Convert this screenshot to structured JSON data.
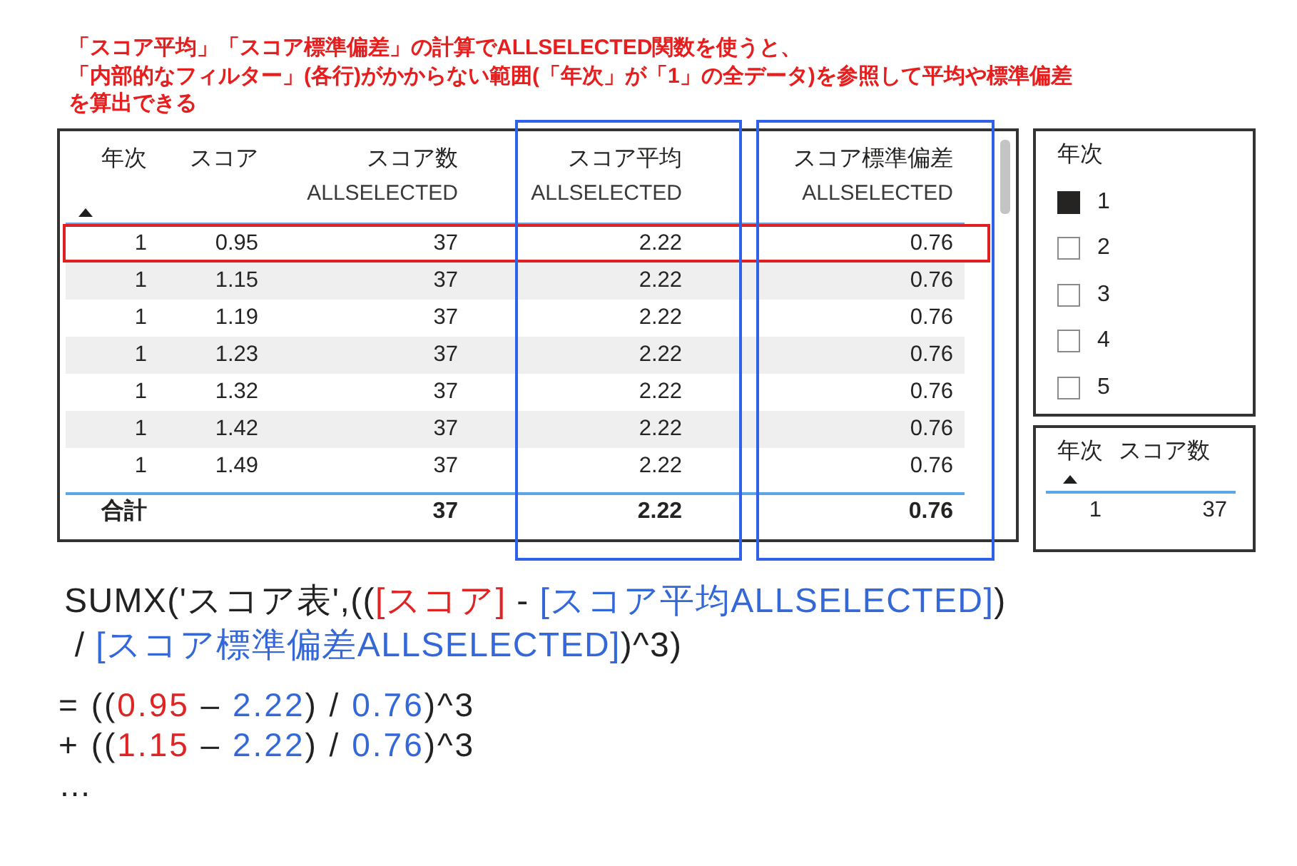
{
  "annotation": {
    "lines": [
      "「スコア平均」「スコア標準偏差」の計算でALLSELECTED関数を使うと、",
      "「内部的なフィルター」(各行)がかからない範囲(「年次」が「1」の全データ)を参照して平均や標準偏差",
      "を算出できる"
    ]
  },
  "table": {
    "columns": [
      {
        "title": "年次",
        "sorted": true,
        "highlighted": false
      },
      {
        "title": "スコア",
        "sorted": false,
        "highlighted": false
      },
      {
        "title": "スコア数",
        "subtitle": "ALLSELECTED",
        "sorted": false,
        "highlighted": false
      },
      {
        "title": "スコア平均",
        "subtitle": "ALLSELECTED",
        "sorted": false,
        "highlighted": true
      },
      {
        "title": "スコア標準偏差",
        "subtitle": "ALLSELECTED",
        "sorted": false,
        "highlighted": true
      }
    ],
    "rows": [
      {
        "cells": [
          "1",
          "0.95",
          "37",
          "2.22",
          "0.76"
        ],
        "highlighted": true
      },
      {
        "cells": [
          "1",
          "1.15",
          "37",
          "2.22",
          "0.76"
        ],
        "highlighted": false
      },
      {
        "cells": [
          "1",
          "1.19",
          "37",
          "2.22",
          "0.76"
        ],
        "highlighted": false
      },
      {
        "cells": [
          "1",
          "1.23",
          "37",
          "2.22",
          "0.76"
        ],
        "highlighted": false
      },
      {
        "cells": [
          "1",
          "1.32",
          "37",
          "2.22",
          "0.76"
        ],
        "highlighted": false
      },
      {
        "cells": [
          "1",
          "1.42",
          "37",
          "2.22",
          "0.76"
        ],
        "highlighted": false
      },
      {
        "cells": [
          "1",
          "1.49",
          "37",
          "2.22",
          "0.76"
        ],
        "highlighted": false
      }
    ],
    "total": {
      "label": "合計",
      "cells": [
        "37",
        "2.22",
        "0.76"
      ]
    }
  },
  "year_slicer": {
    "title": "年次",
    "items": [
      {
        "label": "1",
        "checked": true
      },
      {
        "label": "2",
        "checked": false
      },
      {
        "label": "3",
        "checked": false
      },
      {
        "label": "4",
        "checked": false
      },
      {
        "label": "5",
        "checked": false
      }
    ]
  },
  "summary_table": {
    "columns": [
      {
        "title": "年次",
        "sorted": true
      },
      {
        "title": "スコア数",
        "sorted": false
      }
    ],
    "rows": [
      {
        "cells": [
          "1",
          "37"
        ]
      }
    ]
  },
  "formula": {
    "expression": [
      {
        "segments": [
          {
            "kind": "text",
            "text": "SUMX('スコア表',(("
          },
          {
            "kind": "column",
            "text": "[スコア]"
          },
          {
            "kind": "text",
            "text": " - "
          },
          {
            "kind": "measure",
            "text": "[スコア平均ALLSELECTED]"
          },
          {
            "kind": "text",
            "text": ")"
          }
        ]
      },
      {
        "segments": [
          {
            "kind": "text",
            "text": " / "
          },
          {
            "kind": "measure",
            "text": "[スコア標準偏差ALLSELECTED]"
          },
          {
            "kind": "text",
            "text": ")^3)"
          }
        ]
      }
    ],
    "expansion": [
      {
        "segments": [
          {
            "kind": "text",
            "text": "= (("
          },
          {
            "kind": "column",
            "text": "0.95"
          },
          {
            "kind": "text",
            "text": " – "
          },
          {
            "kind": "measure",
            "text": "2.22"
          },
          {
            "kind": "text",
            "text": ") / "
          },
          {
            "kind": "measure",
            "text": "0.76"
          },
          {
            "kind": "text",
            "text": ")^3"
          }
        ]
      },
      {
        "segments": [
          {
            "kind": "text",
            "text": "+ (("
          },
          {
            "kind": "column",
            "text": "1.15"
          },
          {
            "kind": "text",
            "text": " – "
          },
          {
            "kind": "measure",
            "text": "2.22"
          },
          {
            "kind": "text",
            "text": ") / "
          },
          {
            "kind": "measure",
            "text": "0.76"
          },
          {
            "kind": "text",
            "text": ")^3"
          }
        ]
      },
      {
        "segments": [
          {
            "kind": "text",
            "text": "…"
          }
        ]
      }
    ]
  }
}
